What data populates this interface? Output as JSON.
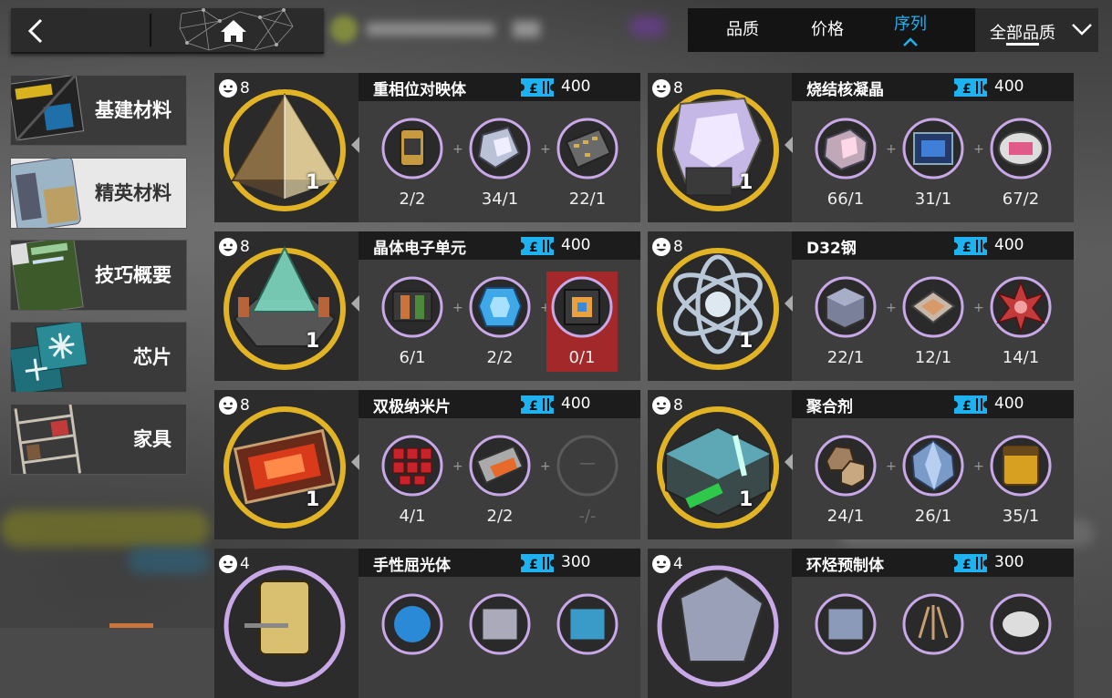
{
  "topbar": {
    "sort_tabs": [
      {
        "label": "品质"
      },
      {
        "label": "价格"
      },
      {
        "label": "序列"
      }
    ],
    "filter_label": "全部品质"
  },
  "sidebar": {
    "categories": [
      {
        "label": "基建材料"
      },
      {
        "label": "精英材料"
      },
      {
        "label": "技巧概要"
      },
      {
        "label": "芯片"
      },
      {
        "label": "家具"
      }
    ]
  },
  "recipes": [
    {
      "level": "8",
      "name": "重相位对映体",
      "price": "400",
      "quantity": "1",
      "ingredients": [
        {
          "count": "2/2"
        },
        {
          "count": "34/1"
        },
        {
          "count": "22/1"
        }
      ]
    },
    {
      "level": "8",
      "name": "烧结核凝晶",
      "price": "400",
      "quantity": "1",
      "ingredients": [
        {
          "count": "66/1"
        },
        {
          "count": "31/1"
        },
        {
          "count": "67/2"
        }
      ]
    },
    {
      "level": "8",
      "name": "晶体电子单元",
      "price": "400",
      "quantity": "1",
      "ingredients": [
        {
          "count": "6/1"
        },
        {
          "count": "2/2"
        },
        {
          "count": "0/1"
        }
      ]
    },
    {
      "level": "8",
      "name": "D32钢",
      "price": "400",
      "quantity": "1",
      "ingredients": [
        {
          "count": "22/1"
        },
        {
          "count": "12/1"
        },
        {
          "count": "14/1"
        }
      ]
    },
    {
      "level": "8",
      "name": "双极纳米片",
      "price": "400",
      "quantity": "1",
      "ingredients": [
        {
          "count": "4/1"
        },
        {
          "count": "2/2"
        },
        {
          "count": "-/-",
          "empty_symbol": "—"
        }
      ]
    },
    {
      "level": "8",
      "name": "聚合剂",
      "price": "400",
      "quantity": "1",
      "ingredients": [
        {
          "count": "24/1"
        },
        {
          "count": "26/1"
        },
        {
          "count": "35/1"
        }
      ]
    },
    {
      "level": "4",
      "name": "手性屈光体",
      "price": "300"
    },
    {
      "level": "4",
      "name": "环烃预制体",
      "price": "300"
    }
  ],
  "colors": {
    "accent": "#1fb2f0",
    "gold_ring": "#e2b425",
    "insufficient": "#a3282a"
  }
}
